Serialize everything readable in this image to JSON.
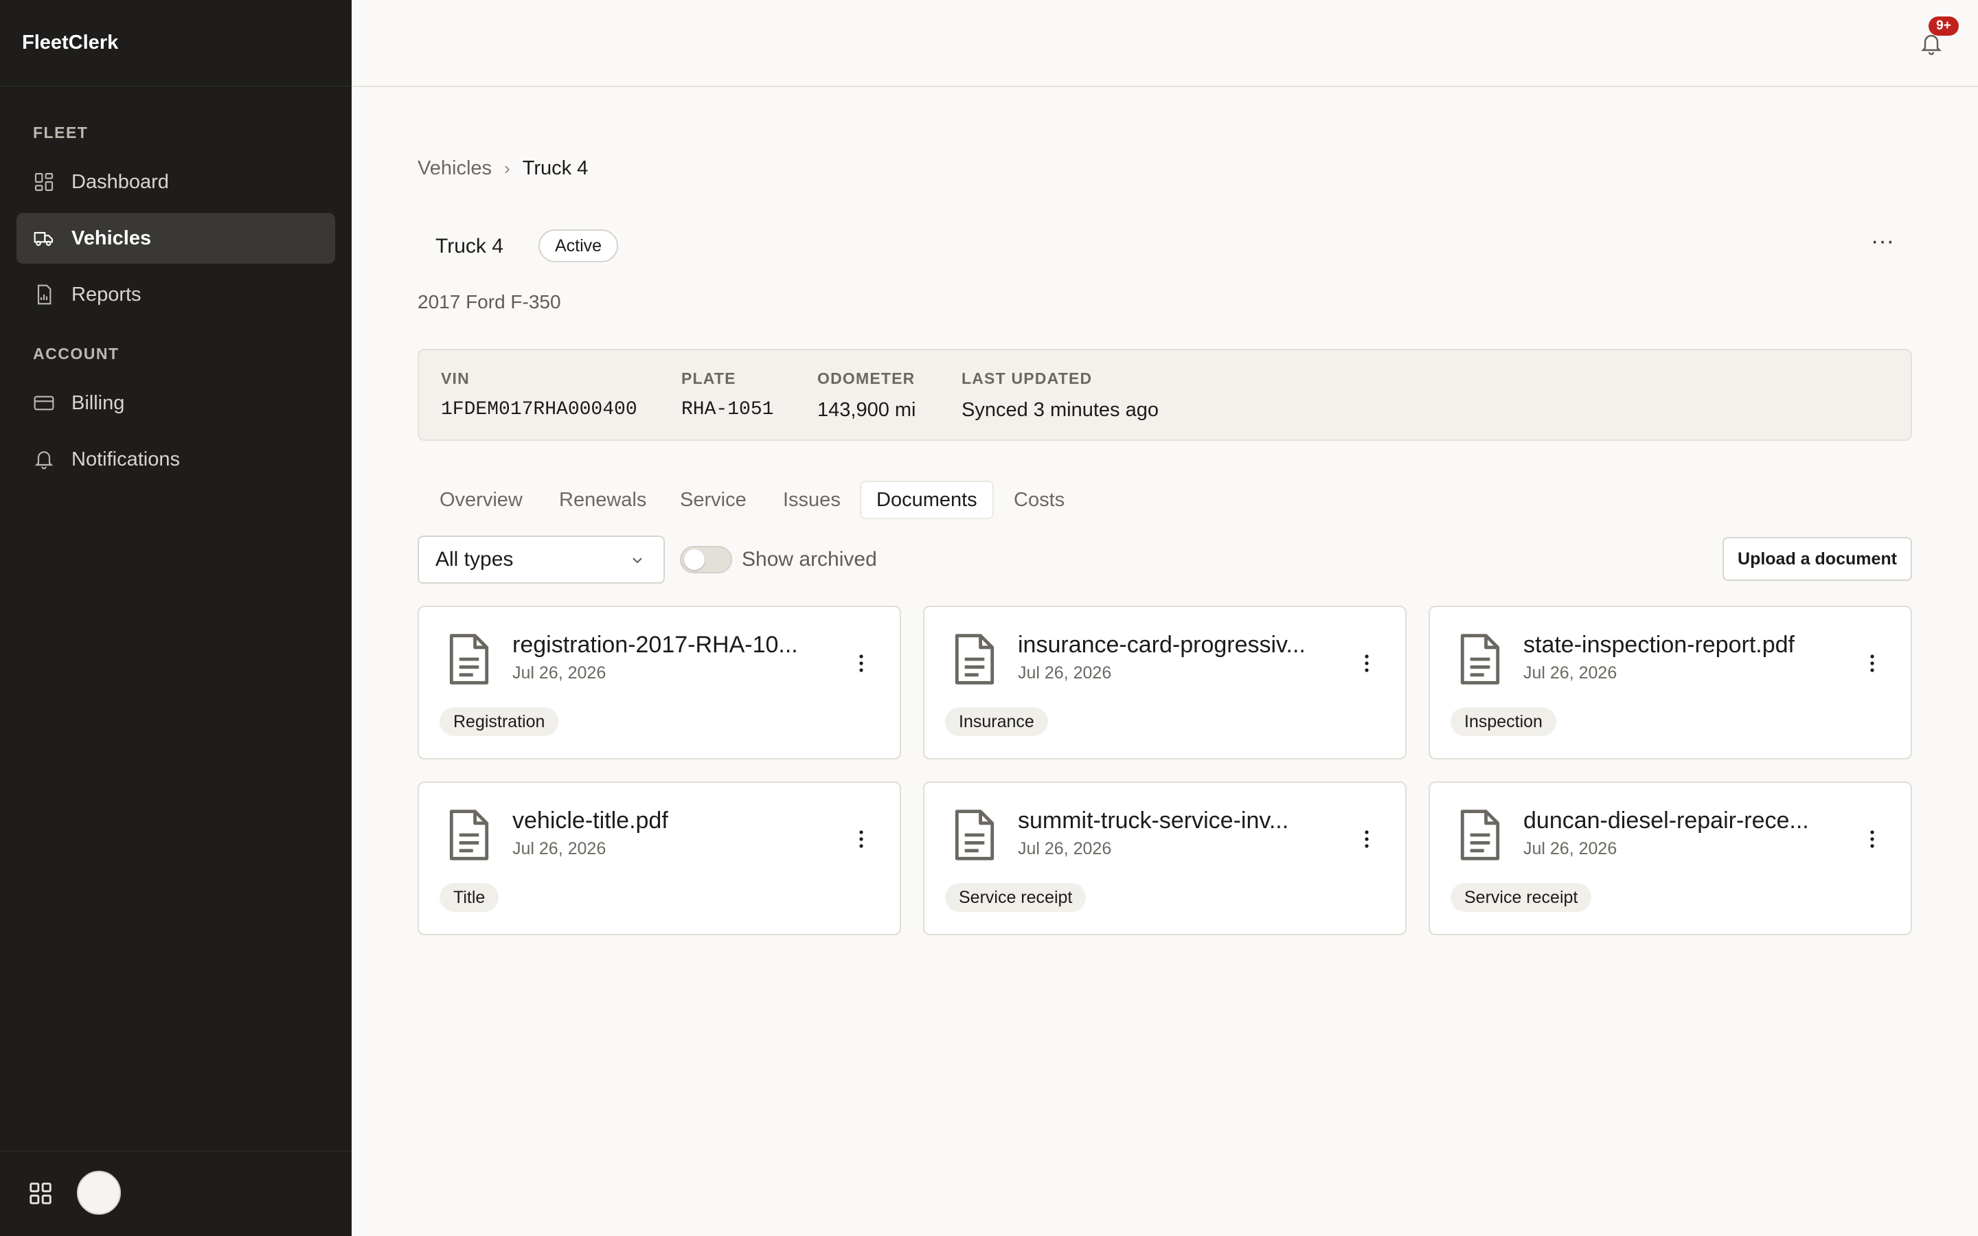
{
  "app": {
    "title": "FleetClerk"
  },
  "sidebar": {
    "sections": [
      {
        "label": "FLEET"
      },
      {
        "label": "ACCOUNT"
      }
    ],
    "items": [
      {
        "label": "Dashboard",
        "icon": "dashboard-icon"
      },
      {
        "label": "Vehicles",
        "icon": "truck-icon",
        "active": true
      },
      {
        "label": "Reports",
        "icon": "report-icon"
      },
      {
        "label": "Billing",
        "icon": "credit-card-icon"
      },
      {
        "label": "Notifications",
        "icon": "bell-icon"
      }
    ]
  },
  "header": {
    "notification_badge": "9+"
  },
  "breadcrumb": {
    "parent": "Vehicles",
    "separator": "›",
    "current": "Truck 4"
  },
  "vehicle": {
    "name": "Truck 4",
    "status": "Active",
    "subtitle": "2017 Ford F-350",
    "more_label": "···"
  },
  "info": [
    {
      "label": "VIN",
      "value": "1FDEM017RHA000400"
    },
    {
      "label": "PLATE",
      "value": "RHA-1051"
    },
    {
      "label": "ODOMETER",
      "value": "143,900 mi"
    },
    {
      "label": "LAST UPDATED",
      "value": "Synced 3 minutes ago"
    }
  ],
  "tabs": [
    {
      "label": "Overview"
    },
    {
      "label": "Renewals"
    },
    {
      "label": "Service"
    },
    {
      "label": "Issues"
    },
    {
      "label": "Documents",
      "active": true
    },
    {
      "label": "Costs"
    }
  ],
  "filters": {
    "type_select": "All types",
    "show_archived_label": "Show archived",
    "show_archived": false,
    "upload_label": "Upload a document"
  },
  "documents": [
    {
      "name": "registration-2017-RHA-10...",
      "date": "Jul 26, 2026",
      "tag": "Registration"
    },
    {
      "name": "insurance-card-progressiv...",
      "date": "Jul 26, 2026",
      "tag": "Insurance"
    },
    {
      "name": "state-inspection-report.pdf",
      "date": "Jul 26, 2026",
      "tag": "Inspection"
    },
    {
      "name": "vehicle-title.pdf",
      "date": "Jul 26, 2026",
      "tag": "Title"
    },
    {
      "name": "summit-truck-service-inv...",
      "date": "Jul 26, 2026",
      "tag": "Service receipt"
    },
    {
      "name": "duncan-diesel-repair-rece...",
      "date": "Jul 26, 2026",
      "tag": "Service receipt"
    }
  ],
  "colors": {
    "sidebar_bg": "#1e1d1b",
    "page_bg": "#faf9f7",
    "badge_red": "#c0211d"
  }
}
